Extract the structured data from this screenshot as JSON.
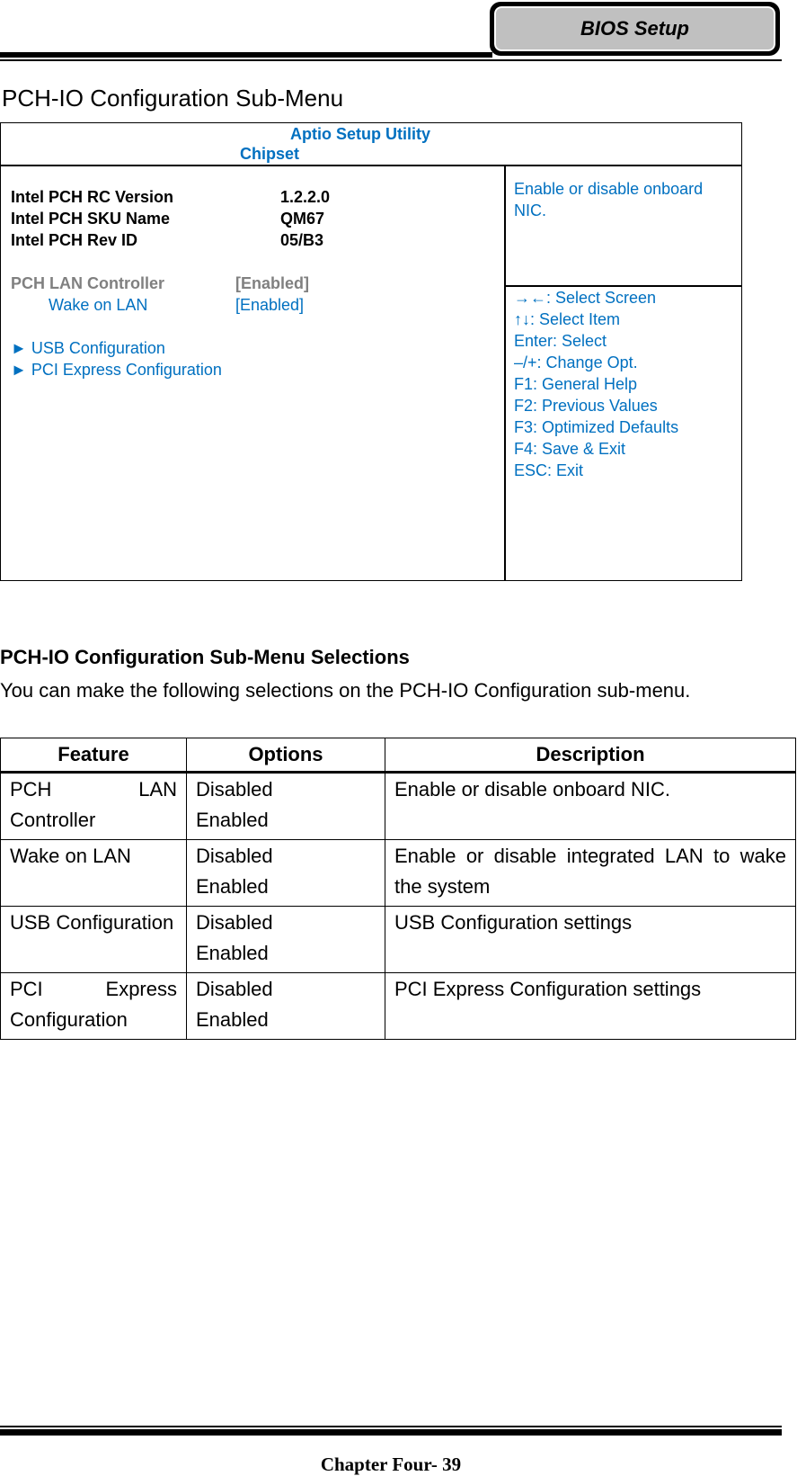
{
  "header": {
    "tab_label": "BIOS Setup"
  },
  "page_title": "PCH-IO Configuration Sub-Menu",
  "bios_screen": {
    "utility_title": "Aptio Setup Utility",
    "screen_name": "Chipset",
    "info": [
      {
        "label": "Intel PCH RC Version",
        "value": "1.2.2.0"
      },
      {
        "label": "Intel PCH SKU Name",
        "value": "QM67"
      },
      {
        "label": "Intel PCH Rev ID",
        "value": "05/B3"
      }
    ],
    "settings": [
      {
        "label": "PCH LAN Controller",
        "value": "[Enabled]",
        "state": "selected-gray"
      },
      {
        "label": "Wake on LAN",
        "value": "[Enabled]",
        "state": "normal"
      }
    ],
    "submenus": [
      {
        "arrow": "►",
        "label": "USB Configuration"
      },
      {
        "arrow": "►",
        "label": "PCI Express Configuration"
      }
    ],
    "help_text": "Enable or disable onboard NIC.",
    "key_help": [
      "→←: Select Screen",
      "↑↓: Select Item",
      "Enter: Select",
      "–/+: Change Opt.",
      "F1: General Help",
      "F2: Previous Values",
      "F3: Optimized Defaults",
      "F4: Save & Exit",
      "ESC: Exit"
    ],
    "colors": {
      "accent": "#0070C0",
      "disabled": "#808080"
    }
  },
  "selections": {
    "heading": "PCH-IO Configuration Sub-Menu Selections",
    "intro": "You can make the following selections on the PCH-IO Configuration sub-menu.",
    "table": {
      "headers": [
        "Feature",
        "Options",
        "Description"
      ],
      "rows": [
        {
          "feature": "PCH LAN Controller",
          "options": [
            "Disabled",
            "Enabled"
          ],
          "description": "Enable or disable onboard NIC."
        },
        {
          "feature": "Wake on LAN",
          "options": [
            "Disabled",
            "Enabled"
          ],
          "description": "Enable or disable integrated LAN to wake the system"
        },
        {
          "feature": "USB Configuration",
          "options": [
            "Disabled",
            "Enabled"
          ],
          "description": "USB Configuration settings"
        },
        {
          "feature": "PCI Express Configuration",
          "options": [
            "Disabled",
            "Enabled"
          ],
          "description": "PCI Express Configuration settings"
        }
      ]
    }
  },
  "footer": {
    "text": "Chapter Four- 39"
  }
}
